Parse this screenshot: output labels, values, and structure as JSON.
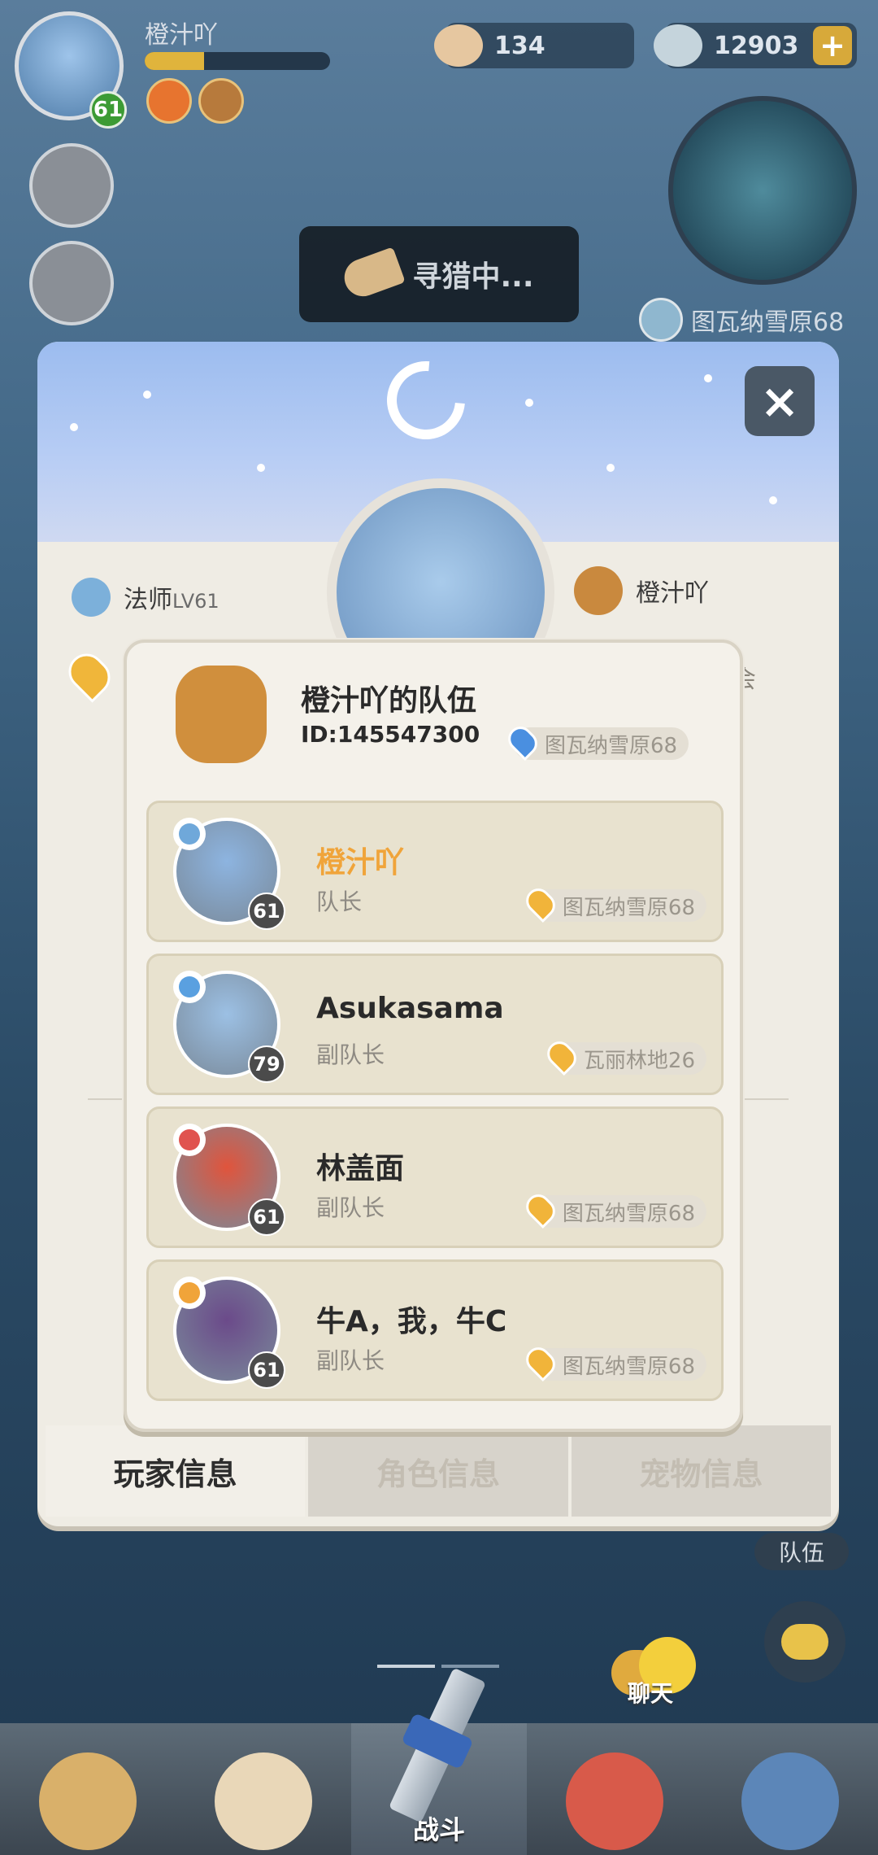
{
  "hud": {
    "player_name": "橙汁吖",
    "level": "61",
    "exp_fraction": 0.32,
    "shells": "134",
    "gems": "12903",
    "plus_label": "+",
    "hunting_label": "寻猎中...",
    "location": "图瓦纳雪原68"
  },
  "panel": {
    "close_label": "×",
    "class_level_prefix": "法师",
    "class_level_suffix": "LV61",
    "team_owner": "橙汁吖",
    "partial_right": "会",
    "tabs": [
      {
        "label": "玩家信息",
        "active": true
      },
      {
        "label": "角色信息",
        "active": false
      },
      {
        "label": "宠物信息",
        "active": false
      }
    ]
  },
  "team_popup": {
    "title": "橙汁吖的队伍",
    "id_label": "ID:145547300",
    "location": "图瓦纳雪原68",
    "members": [
      {
        "name": "橙汁吖",
        "role": "队长",
        "level": "61",
        "location": "图瓦纳雪原68",
        "leader": true,
        "badge_color": "#6fa8da",
        "avatar_color": "#8db4e0"
      },
      {
        "name": "Asukasama",
        "role": "副队长",
        "level": "79",
        "location": "瓦丽林地26",
        "leader": false,
        "badge_color": "#5aa0e0",
        "avatar_color": "#9cc0e4"
      },
      {
        "name": "林盖面",
        "role": "副队长",
        "level": "61",
        "location": "图瓦纳雪原68",
        "leader": false,
        "badge_color": "#e0534f",
        "avatar_color": "#e0543c"
      },
      {
        "name": "牛A，我，牛C",
        "role": "副队长",
        "level": "61",
        "location": "图瓦纳雪原68",
        "leader": false,
        "badge_color": "#f0a43a",
        "avatar_color": "#6b4a8a"
      }
    ]
  },
  "bottom": {
    "team_label": "队伍",
    "chat_label": "聊天",
    "nav": [
      {
        "label": "",
        "icon": "caveman-icon"
      },
      {
        "label": "",
        "icon": "hero-icon"
      },
      {
        "label": "战斗",
        "icon": "sword-icon"
      },
      {
        "label": "",
        "icon": "pet-icon"
      },
      {
        "label": "",
        "icon": "totem-icon"
      }
    ]
  },
  "colors": {
    "leader_name": "#f0a43a",
    "level_badge": "#3c9b34",
    "panel_bg": "#efece4",
    "card_bg": "#e8e2cf"
  }
}
